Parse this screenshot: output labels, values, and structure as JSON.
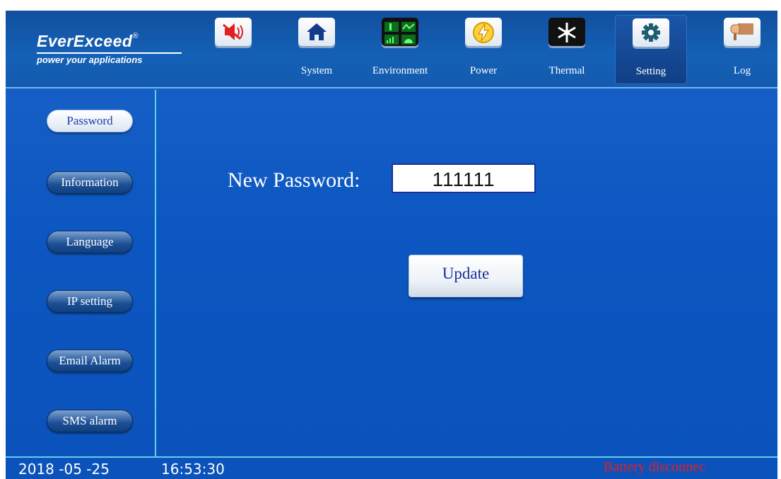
{
  "brand": {
    "name": "EverExceed",
    "registered": "®",
    "tagline": "power your applications"
  },
  "nav": [
    {
      "id": "mute",
      "label": "",
      "icon": "mute-alarm-icon"
    },
    {
      "id": "system",
      "label": "System",
      "icon": "home-icon"
    },
    {
      "id": "environment",
      "label": "Environment",
      "icon": "environment-monitor-icon"
    },
    {
      "id": "power",
      "label": "Power",
      "icon": "lightning-icon"
    },
    {
      "id": "thermal",
      "label": "Thermal",
      "icon": "snowflake-icon"
    },
    {
      "id": "setting",
      "label": "Setting",
      "icon": "gear-icon",
      "active": true
    },
    {
      "id": "log",
      "label": "Log",
      "icon": "log-icon"
    }
  ],
  "sidebar": {
    "items": [
      {
        "label": "Password",
        "active": true
      },
      {
        "label": "Information"
      },
      {
        "label": "Language"
      },
      {
        "label": "IP setting"
      },
      {
        "label": "Email Alarm"
      },
      {
        "label": "SMS alarm"
      }
    ]
  },
  "form": {
    "new_password_label": "New Password:",
    "new_password_value": "111111",
    "update_label": "Update"
  },
  "status": {
    "date": "2018 -05 -25",
    "time": "16:53:30",
    "alarm": "Battery disconnec"
  },
  "colors": {
    "background": "#0d57c2",
    "accent_line": "#5fd0e8",
    "alarm_text": "#e32020",
    "button_text": "#1a2f9a"
  }
}
